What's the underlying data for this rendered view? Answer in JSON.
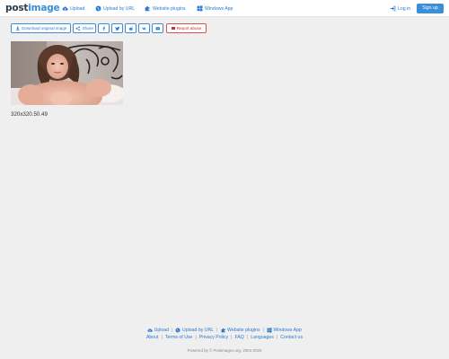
{
  "header": {
    "logo_main": "post",
    "logo_accent": "image",
    "nav": {
      "upload": "Upload",
      "upload_url": "Upload by URL",
      "plugins": "Website plugins",
      "windows_app": "Windows App"
    },
    "login": "Log in",
    "signup": "Sign up"
  },
  "toolbar": {
    "download": "Download original image",
    "share": "Share",
    "report": "Report abuse",
    "icons": [
      "facebook-icon",
      "twitter-icon",
      "reddit-icon",
      "vk-icon",
      "email-icon"
    ]
  },
  "image": {
    "caption": "320x320.50.49"
  },
  "footer": {
    "row1": {
      "upload": "Upload",
      "upload_url": "Upload by URL",
      "plugins": "Website plugins",
      "windows_app": "Windows App"
    },
    "row2": {
      "about": "About",
      "terms": "Terms of Use",
      "privacy": "Privacy Policy",
      "faq": "FAQ",
      "languages": "Languages",
      "contact": "Contact us"
    },
    "powered": "Powered by © Postimages.org, 2004-2025"
  },
  "colors": {
    "accent": "#3b8ed8",
    "link": "#2a7ad2",
    "danger": "#d9534f",
    "background": "#efefef"
  }
}
